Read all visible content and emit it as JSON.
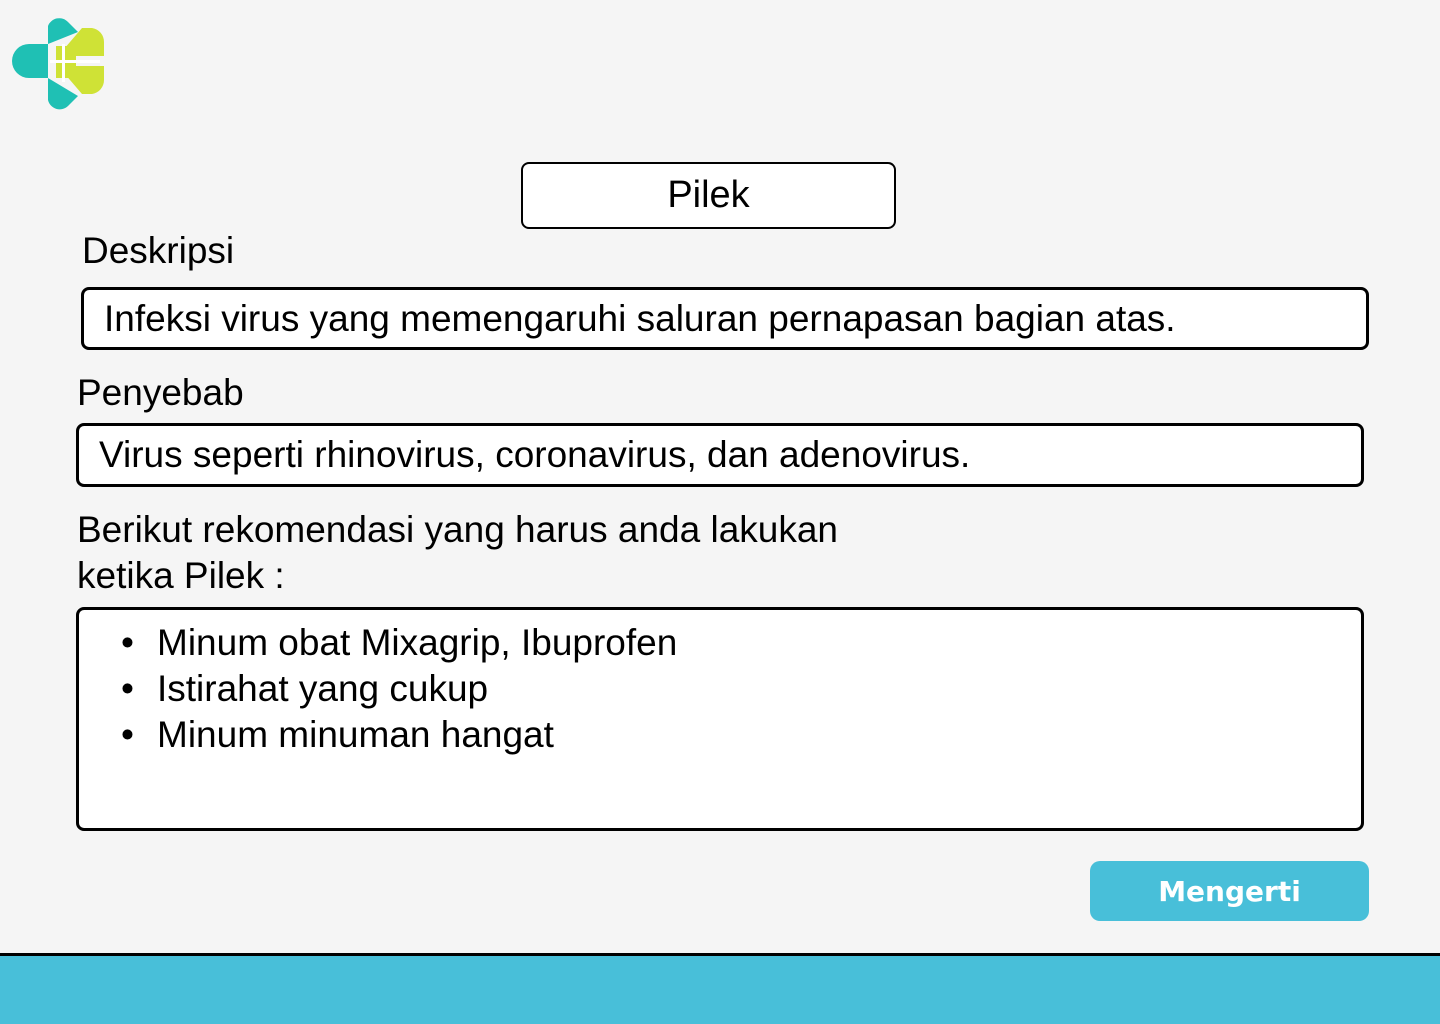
{
  "brand": {
    "logo_icon": "kemenkes-logo-icon",
    "teal": "#1fc0b4",
    "lime": "#cfe236"
  },
  "title": "Pilek",
  "description": {
    "label": "Deskripsi",
    "value": "Infeksi virus yang memengaruhi saluran pernapasan bagian atas."
  },
  "cause": {
    "label": "Penyebab",
    "value": "Virus seperti rhinovirus, coronavirus, dan adenovirus."
  },
  "recommendations": {
    "heading_line1": "Berikut rekomendasi yang harus anda lakukan",
    "heading_line2": "ketika Pilek :",
    "items": [
      "Minum obat Mixagrip, Ibuprofen",
      "Istirahat yang cukup",
      "Minum minuman hangat"
    ]
  },
  "confirm_button": "Mengerti",
  "colors": {
    "accent": "#48bfd9",
    "background": "#f5f5f5"
  }
}
